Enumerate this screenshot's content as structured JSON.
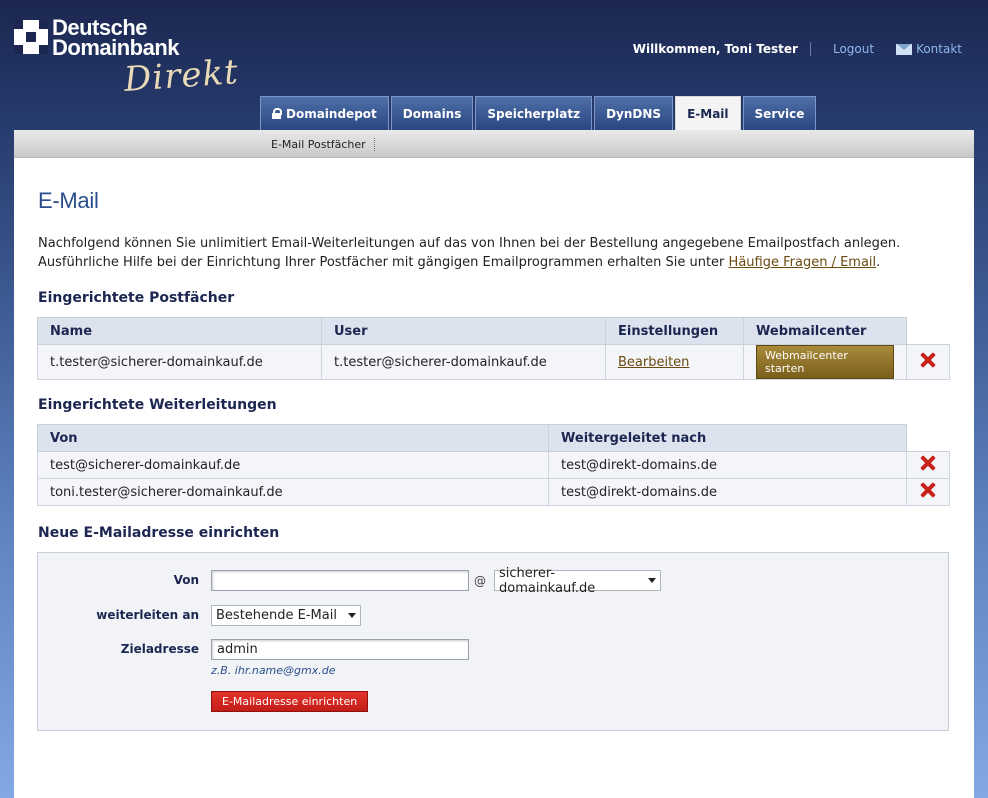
{
  "brand": {
    "line1": "Deutsche",
    "line2": "Domainbank",
    "script": "Direkt"
  },
  "topbar": {
    "welcome": "Willkommen, Toni Tester",
    "logout": "Logout",
    "contact": "Kontakt"
  },
  "tabs": [
    {
      "label": "Domaindepot"
    },
    {
      "label": "Domains"
    },
    {
      "label": "Speicherplatz"
    },
    {
      "label": "DynDNS"
    },
    {
      "label": "E-Mail",
      "active": true
    },
    {
      "label": "Service"
    }
  ],
  "subnav": {
    "item": "E-Mail Postfächer"
  },
  "page": {
    "title": "E-Mail",
    "intro_line1": "Nachfolgend können Sie unlimitiert Email-Weiterleitungen auf das von Ihnen bei der Bestellung angegebene Emailpostfach anlegen.",
    "intro_line2_prefix": "Ausführliche Hilfe bei der Einrichtung Ihrer Postfächer mit gängigen Emailprogrammen erhalten Sie unter ",
    "intro_link": "Häufige Fragen / Email",
    "intro_line2_suffix": "."
  },
  "mailboxes": {
    "heading": "Eingerichtete Postfächer",
    "columns": [
      "Name",
      "User",
      "Einstellungen",
      "Webmailcenter"
    ],
    "rows": [
      {
        "name": "t.tester@sicherer-domainkauf.de",
        "user": "t.tester@sicherer-domainkauf.de",
        "settings": "Bearbeiten",
        "webmail": "Webmailcenter starten"
      }
    ]
  },
  "forwards": {
    "heading": "Eingerichtete Weiterleitungen",
    "columns": [
      "Von",
      "Weitergeleitet nach"
    ],
    "rows": [
      {
        "from": "test@sicherer-domainkauf.de",
        "to": "test@direkt-domains.de"
      },
      {
        "from": "toni.tester@sicherer-domainkauf.de",
        "to": "test@direkt-domains.de"
      }
    ]
  },
  "form": {
    "heading": "Neue E-Mailadresse einrichten",
    "from_label": "Von",
    "from_value": "",
    "at": "@",
    "domain_selected": "sicherer-domainkauf.de",
    "forward_label": "weiterleiten an",
    "forward_selected": "Bestehende E-Mail",
    "target_label": "Zieladresse",
    "target_value": "admin",
    "hint": "z.B. ihr.name@gmx.de",
    "submit": "E-Mailadresse einrichten"
  }
}
